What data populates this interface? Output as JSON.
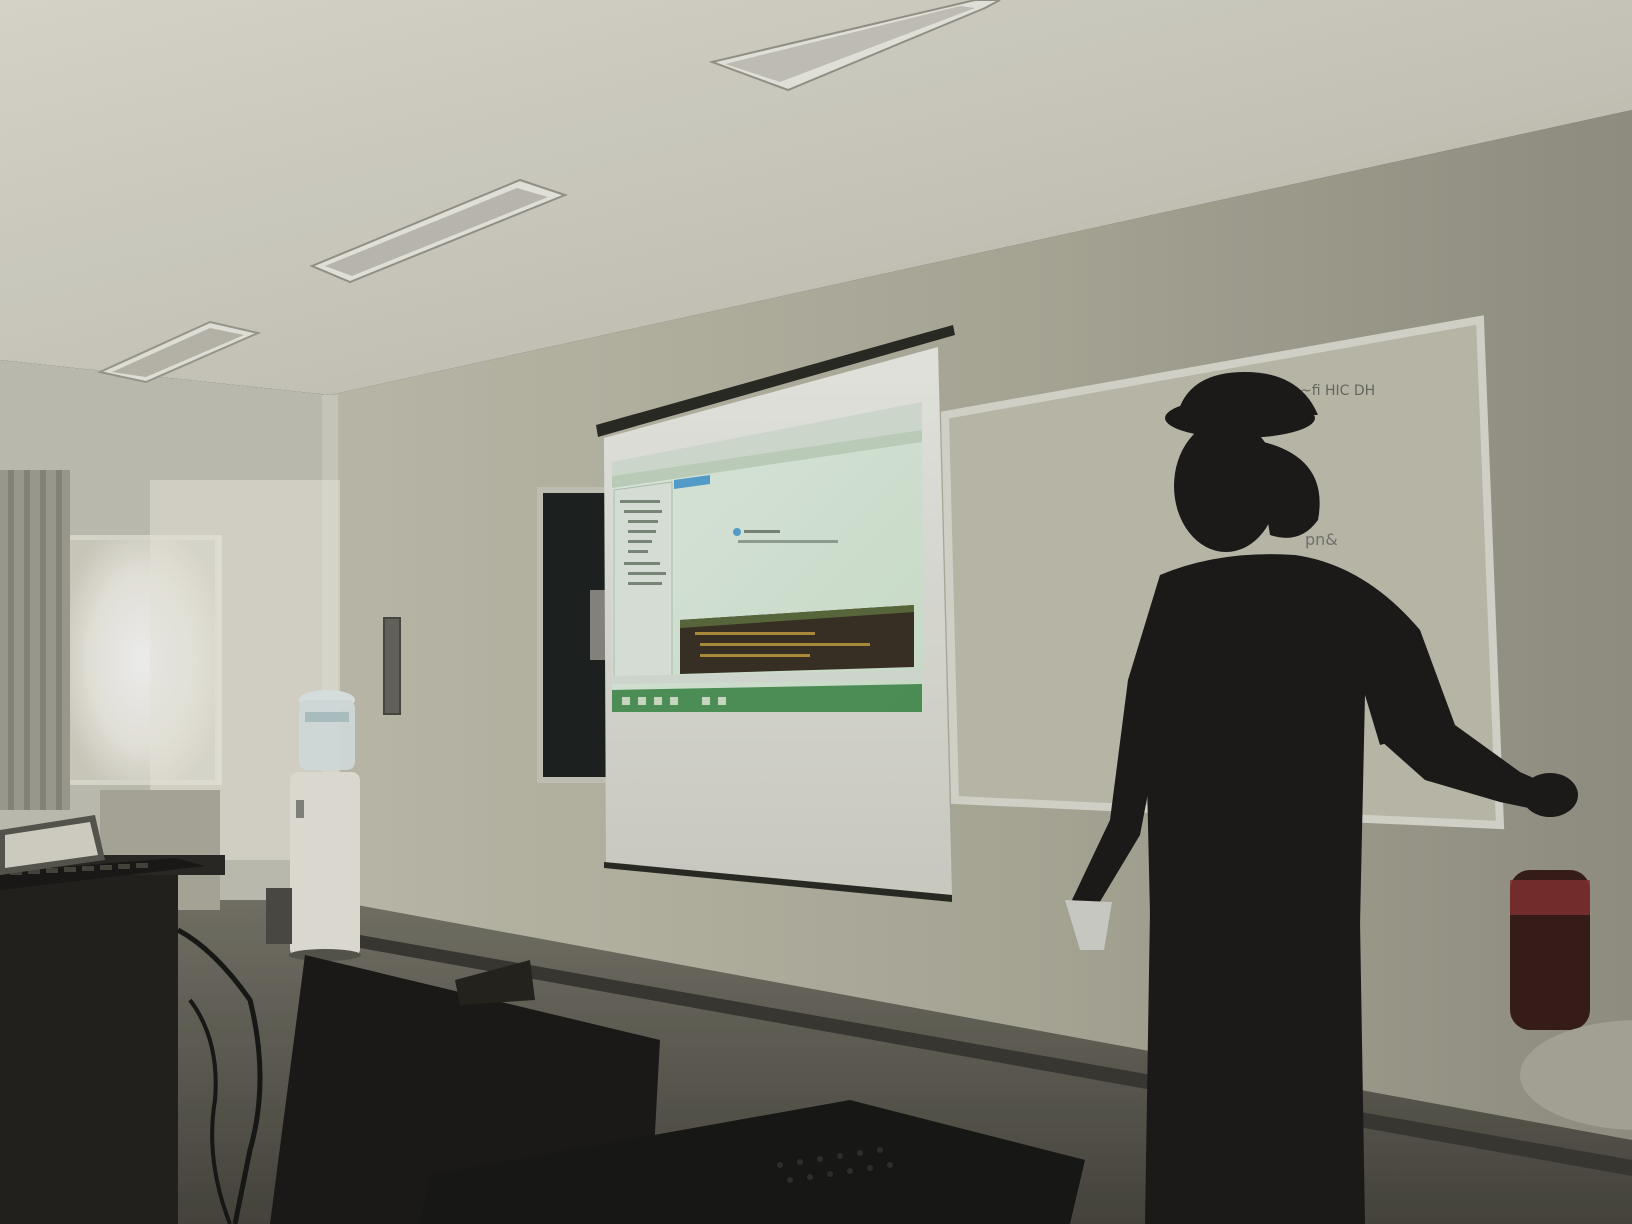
{
  "scene": {
    "palette": {
      "ceiling": "#d9d8cc",
      "wall": "#b9b7a6",
      "wall_dark": "#77766a",
      "window_light": "#ffffff",
      "screen_glow": "#eef4e8",
      "ide_accent": "#5aa8d8",
      "ide_console": "#3c3428",
      "taskbar": "#2e7d3a",
      "silhouette": "#1e1c1a"
    },
    "icons": [
      "ceiling-vent",
      "projection-screen",
      "whiteboard",
      "water-cooler",
      "presenter-silhouette",
      "chair",
      "computer-desk",
      "keyboard"
    ]
  }
}
